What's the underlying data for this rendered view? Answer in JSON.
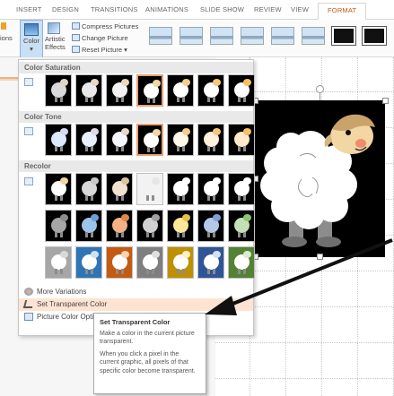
{
  "ribbon": {
    "tabs": [
      {
        "label": "INSERT"
      },
      {
        "label": "DESIGN"
      },
      {
        "label": "TRANSITIONS"
      },
      {
        "label": "ANIMATIONS"
      },
      {
        "label": "SLIDE SHOW"
      },
      {
        "label": "REVIEW"
      },
      {
        "label": "VIEW"
      },
      {
        "label": "FORMAT",
        "active": true
      }
    ],
    "left_cut_label": "ions",
    "color_label": "Color",
    "artistic_label": "Artistic",
    "effects_label": "Effects",
    "compress_label": "Compress Pictures",
    "change_label": "Change Picture",
    "reset_label": "Reset Picture",
    "accent_color": "#c55a11"
  },
  "dropdown": {
    "saturation_header": "Color Saturation",
    "tone_header": "Color Tone",
    "recolor_header": "Recolor",
    "saturation_row": [
      {
        "wool": "#d9d9d9",
        "head": "#e0d6c8"
      },
      {
        "wool": "#e9e9e9",
        "head": "#e6d8c4"
      },
      {
        "wool": "#f2f2f2",
        "head": "#ead9bd"
      },
      {
        "wool": "#ffffff",
        "head": "#f2d6a3",
        "selected": true
      },
      {
        "wool": "#ffffff",
        "head": "#f5cf8f"
      },
      {
        "wool": "#ffffff",
        "head": "#f8c878"
      },
      {
        "wool": "#ffffff",
        "head": "#fbbf5e"
      }
    ],
    "tone_row": [
      {
        "wool": "#dbe9ff",
        "head": "#d6d9f2"
      },
      {
        "wool": "#e6f0ff",
        "head": "#dfd8e6"
      },
      {
        "wool": "#f3f6ff",
        "head": "#ead7c9"
      },
      {
        "wool": "#ffffff",
        "head": "#f2d6a3",
        "selected": true
      },
      {
        "wool": "#fff7ea",
        "head": "#f6cf8c"
      },
      {
        "wool": "#fff1dc",
        "head": "#f7c67a"
      },
      {
        "wool": "#ffe9c9",
        "head": "#f9bd66"
      }
    ],
    "recolor_rows": [
      [
        {
          "wool": "#ffffff",
          "head": "#f2d6a3",
          "bg": "#000000"
        },
        {
          "wool": "#d8d8d8",
          "head": "#c8c8c8",
          "bg": "#000000"
        },
        {
          "wool": "#efe3cf",
          "head": "#d9c3a0",
          "bg": "#000000"
        },
        {
          "wool": "#f2f2f2",
          "head": "#e6e6e6",
          "bg": "#f2f2f2"
        },
        {
          "wool": "#ffffff",
          "head": "#ffffff",
          "bg": "#000000"
        },
        {
          "wool": "#ffffff",
          "head": "#ffffff",
          "bg": "#000000"
        },
        {
          "wool": "#ffffff",
          "head": "#ffffff",
          "bg": "#000000"
        }
      ],
      [
        {
          "wool": "#a6a6a6",
          "head": "#8c8c8c",
          "bg": "#000000"
        },
        {
          "wool": "#9cc3ea",
          "head": "#6e9fd6",
          "bg": "#000000"
        },
        {
          "wool": "#f4b183",
          "head": "#e0864a",
          "bg": "#000000"
        },
        {
          "wool": "#d0d0d0",
          "head": "#a0a0a0",
          "bg": "#000000"
        },
        {
          "wool": "#ffe699",
          "head": "#e5c04a",
          "bg": "#000000"
        },
        {
          "wool": "#b4c7e7",
          "head": "#7f9ed6",
          "bg": "#000000"
        },
        {
          "wool": "#c5e0b4",
          "head": "#8fc36e",
          "bg": "#000000"
        }
      ],
      [
        {
          "wool": "#ffffff",
          "head": "#d9d9d9",
          "bg": "#a6a6a6"
        },
        {
          "wool": "#ffffff",
          "head": "#cfe0f5",
          "bg": "#2e75b6"
        },
        {
          "wool": "#ffffff",
          "head": "#f8d3b8",
          "bg": "#c55a11"
        },
        {
          "wool": "#ffffff",
          "head": "#e0e0e0",
          "bg": "#7f7f7f"
        },
        {
          "wool": "#ffffff",
          "head": "#fff0bf",
          "bg": "#bf9000"
        },
        {
          "wool": "#ffffff",
          "head": "#d5e0f3",
          "bg": "#2f5597"
        },
        {
          "wool": "#ffffff",
          "head": "#d9ecd0",
          "bg": "#538135"
        }
      ]
    ],
    "more_variations": "More Variations",
    "set_transparent": "Set Transparent Color",
    "picture_color_options": "Picture Color Options..."
  },
  "tooltip": {
    "title": "Set Transparent Color",
    "line1": "Make a color in the current picture transparent.",
    "line2": "When you click a pixel in the current graphic, all pixels of that specific color become transparent."
  }
}
